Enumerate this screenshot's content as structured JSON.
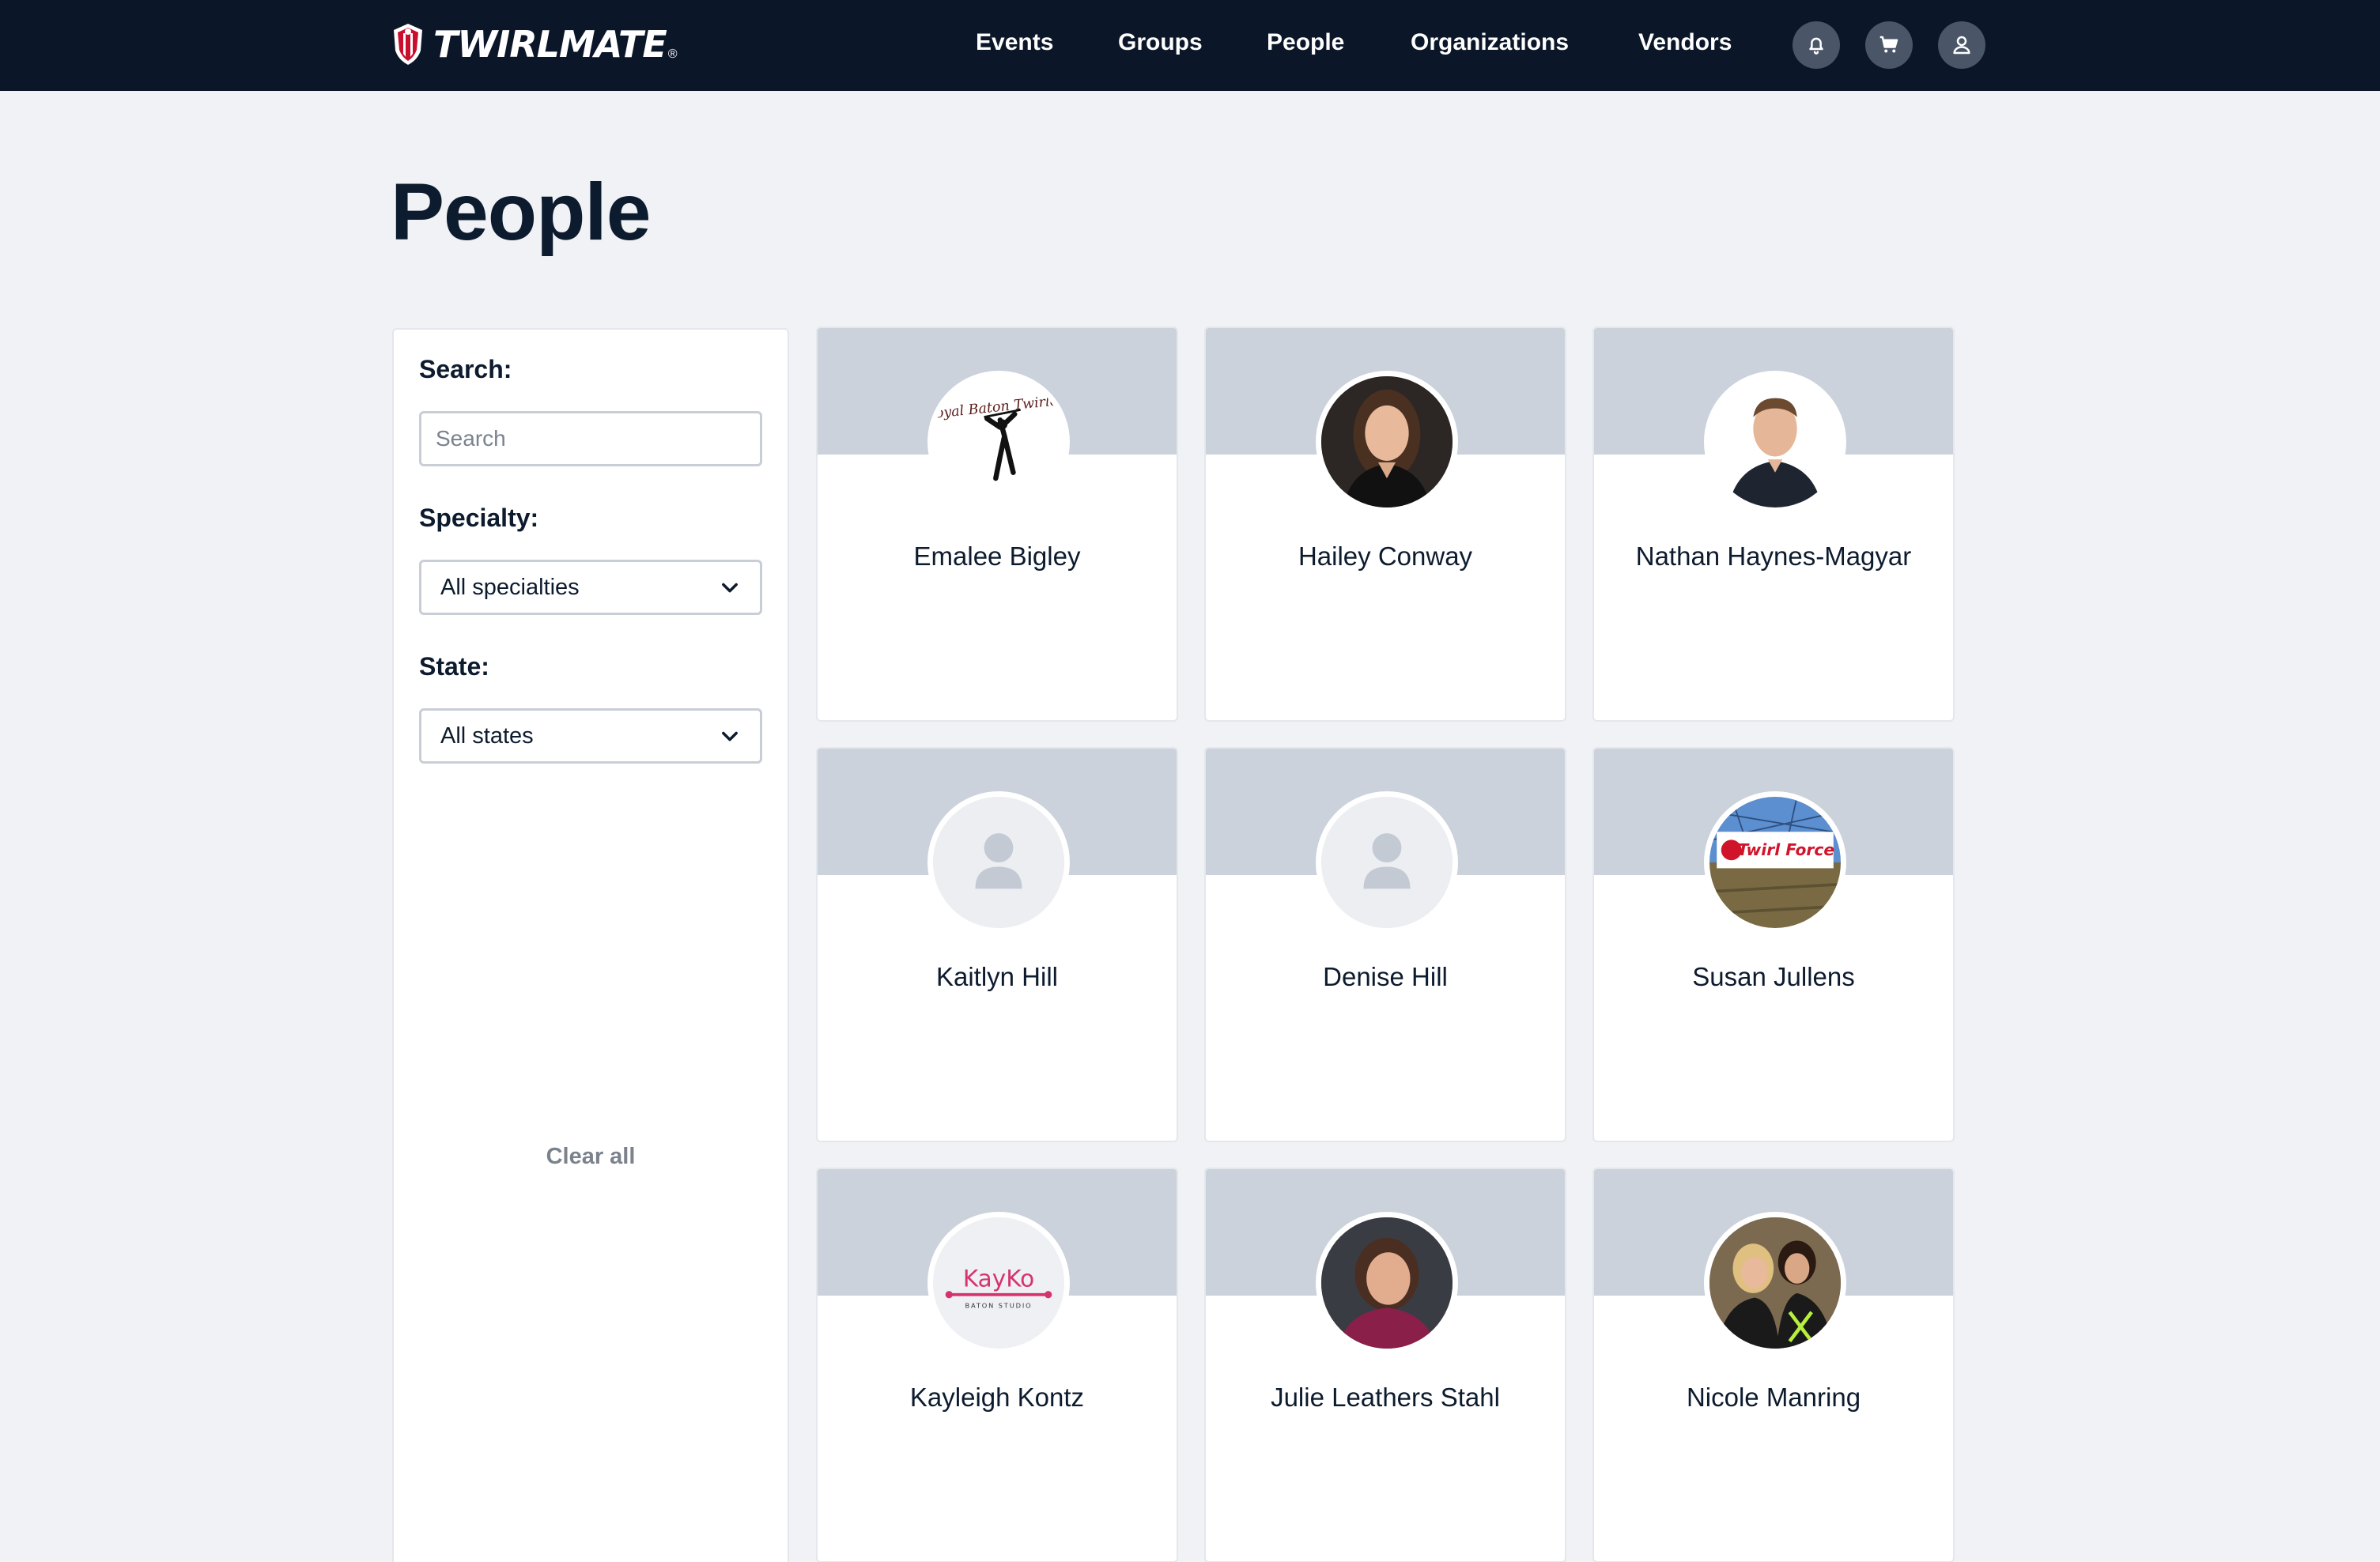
{
  "header": {
    "brand": "TWIRLMATE",
    "brand_mark": "®",
    "nav": [
      "Events",
      "Groups",
      "People",
      "Organizations",
      "Vendors"
    ],
    "icons": [
      "bell-icon",
      "cart-icon",
      "user-icon"
    ]
  },
  "page": {
    "title": "People"
  },
  "filters": {
    "search_label": "Search:",
    "search_placeholder": "Search",
    "search_value": "",
    "specialty_label": "Specialty:",
    "specialty_value": "All specialties",
    "state_label": "State:",
    "state_value": "All states",
    "clear_all": "Clear all"
  },
  "people": [
    {
      "name": "Emalee Bigley",
      "avatar": "logo-royal-baton-twirlers",
      "logo_text": "Royal Baton Twirlers"
    },
    {
      "name": "Hailey Conway",
      "avatar": "photo-woman-dark-hair"
    },
    {
      "name": "Nathan Haynes-Magyar",
      "avatar": "photo-man"
    },
    {
      "name": "Kaitlyn Hill",
      "avatar": "placeholder-person"
    },
    {
      "name": "Denise Hill",
      "avatar": "placeholder-person"
    },
    {
      "name": "Susan Jullens",
      "avatar": "photo-twirl-force-sign",
      "logo_text": "Twirl Force"
    },
    {
      "name": "Kayleigh Kontz",
      "avatar": "logo-kayko",
      "logo_text": "KayKo",
      "logo_subtext": "BATON STUDIO"
    },
    {
      "name": "Julie Leathers Stahl",
      "avatar": "photo-woman-short-hair"
    },
    {
      "name": "Nicole Manring",
      "avatar": "photo-two-women"
    }
  ],
  "colors": {
    "header_bg": "#0b1629",
    "page_bg": "#f0f2f5",
    "banner": "#cbd2db",
    "kayko_pink": "#d6336c"
  }
}
